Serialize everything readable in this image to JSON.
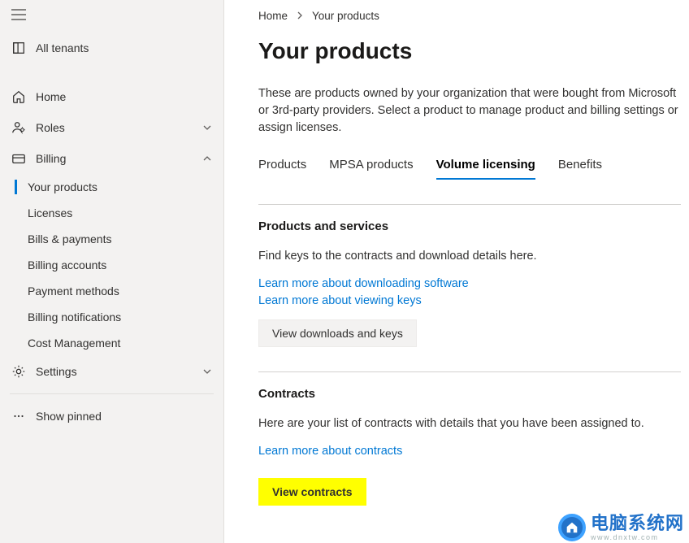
{
  "sidebar": {
    "top": {
      "all_tenants": "All tenants"
    },
    "home": "Home",
    "roles": "Roles",
    "billing": {
      "label": "Billing",
      "children": {
        "your_products": "Your products",
        "licenses": "Licenses",
        "bills_payments": "Bills & payments",
        "billing_accounts": "Billing accounts",
        "payment_methods": "Payment methods",
        "billing_notifications": "Billing notifications",
        "cost_management": "Cost Management"
      }
    },
    "settings": "Settings",
    "show_pinned": "Show pinned"
  },
  "breadcrumb": {
    "home": "Home",
    "current": "Your products"
  },
  "page": {
    "title": "Your products",
    "intro": "These are products owned by your organization that were bought from Microsoft or 3rd-party providers. Select a product to manage product and billing settings or assign licenses."
  },
  "tabs": {
    "products": "Products",
    "mpsa": "MPSA products",
    "volume": "Volume licensing",
    "benefits": "Benefits"
  },
  "section1": {
    "heading": "Products and services",
    "body": "Find keys to the contracts and download details here.",
    "link1": "Learn more about downloading software",
    "link2": "Learn more about viewing keys",
    "button": "View downloads and keys"
  },
  "section2": {
    "heading": "Contracts",
    "body": "Here are your list of contracts with details that you have been assigned to.",
    "link1": "Learn more about contracts",
    "button": "View contracts"
  },
  "watermark": {
    "main": "电脑系统网",
    "sub": "www.dnxtw.com"
  }
}
